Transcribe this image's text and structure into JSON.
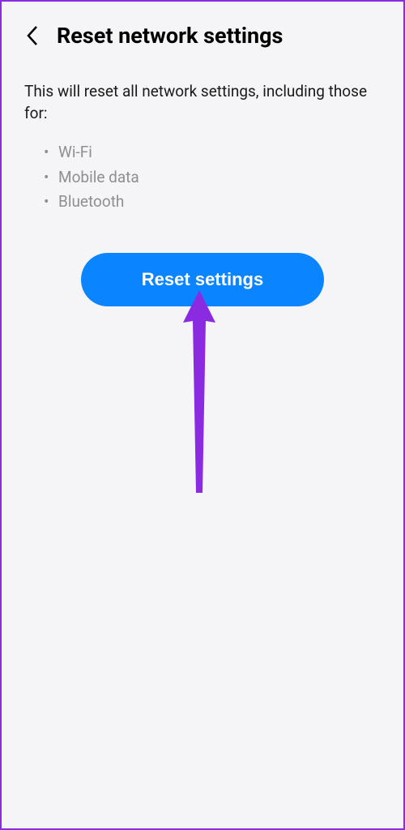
{
  "header": {
    "title": "Reset network settings"
  },
  "description": "This will reset all network settings, including those for:",
  "list": {
    "items": [
      "Wi-Fi",
      "Mobile data",
      "Bluetooth"
    ]
  },
  "button": {
    "label": "Reset settings"
  }
}
